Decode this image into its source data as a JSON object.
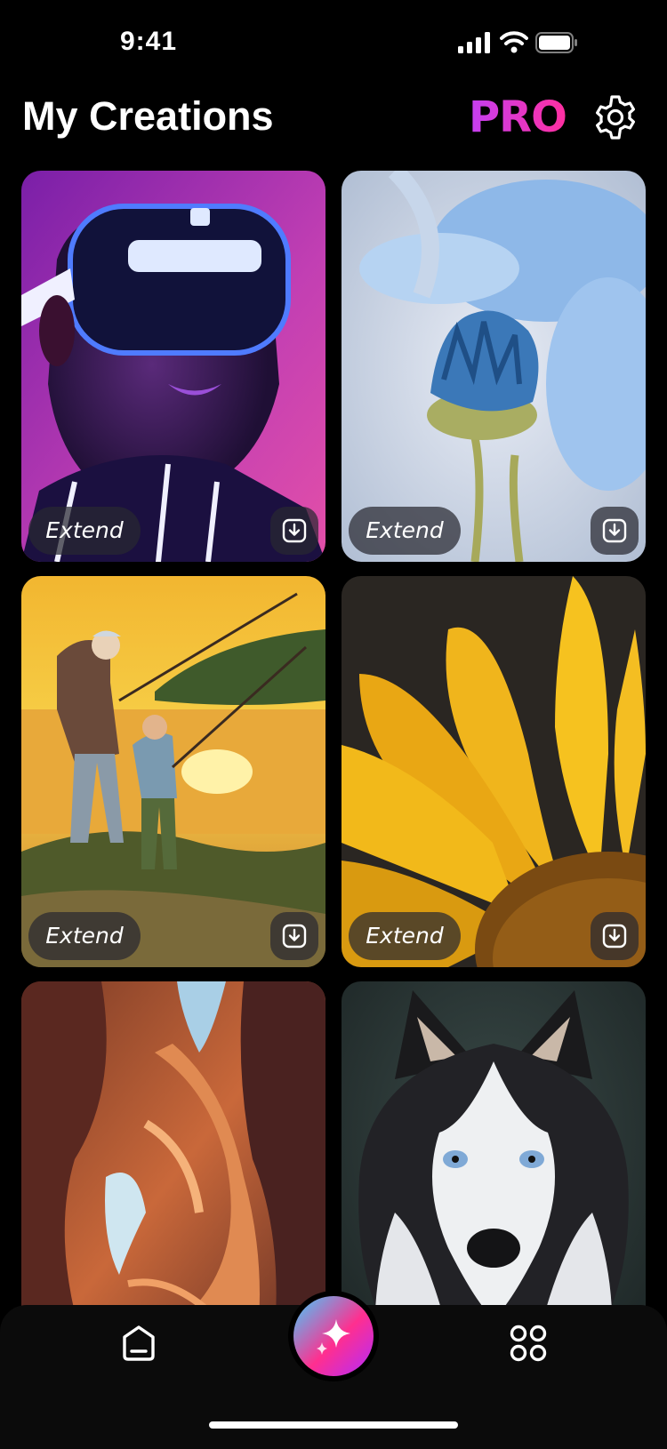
{
  "status": {
    "time": "9:41"
  },
  "header": {
    "title": "My Creations",
    "pro_label": "PRO"
  },
  "cards": [
    {
      "extend_label": "Extend"
    },
    {
      "extend_label": "Extend"
    },
    {
      "extend_label": "Extend"
    },
    {
      "extend_label": "Extend"
    }
  ],
  "icons": {
    "settings": "gear-icon",
    "download": "download-icon",
    "home": "home-icon",
    "create": "sparkle-icon",
    "apps": "grid-icon"
  },
  "colors": {
    "pro_start": "#c43ff2",
    "pro_end": "#ff2fa0",
    "background": "#000000"
  }
}
